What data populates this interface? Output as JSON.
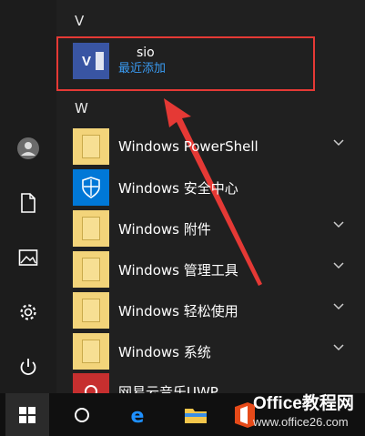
{
  "groups": {
    "v": "V",
    "w": "W"
  },
  "highlight": {
    "app_partial": "sio",
    "app_sub": "最近添加"
  },
  "apps": [
    {
      "label": "Windows PowerShell",
      "icon": "folder-icon",
      "expandable": true
    },
    {
      "label": "Windows 安全中心",
      "icon": "shield-icon",
      "expandable": false
    },
    {
      "label": "Windows 附件",
      "icon": "folder-icon",
      "expandable": true
    },
    {
      "label": "Windows 管理工具",
      "icon": "folder-icon",
      "expandable": true
    },
    {
      "label": "Windows 轻松使用",
      "icon": "folder-icon",
      "expandable": true
    },
    {
      "label": "Windows 系统",
      "icon": "folder-icon",
      "expandable": true
    },
    {
      "label": "网易云音乐UWP",
      "icon": "netease-music-icon",
      "expandable": false
    }
  ],
  "watermark": {
    "brand": "Office教程网",
    "url": "www.office26.com"
  },
  "colors": {
    "accent_blue": "#0078d7",
    "highlight_red": "#e53935",
    "folder_yellow": "#f3d47a",
    "visio_blue": "#3955a3"
  }
}
